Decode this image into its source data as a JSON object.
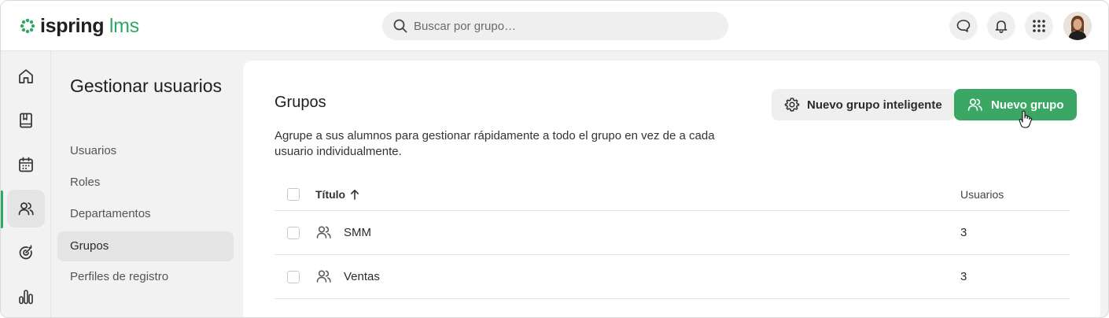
{
  "header": {
    "logo": {
      "primary": "ispring",
      "secondary": "lms"
    },
    "search": {
      "placeholder": "Buscar por grupo…",
      "value": ""
    },
    "icons": [
      "chat-icon",
      "bell-icon",
      "apps-grid-icon"
    ],
    "avatar": "user-avatar"
  },
  "rail": {
    "items": [
      "home-icon",
      "courses-book-icon",
      "calendar-icon",
      "users-icon",
      "goals-target-icon",
      "reports-chart-icon"
    ],
    "active_index": 3,
    "accent_color": "#2fa866"
  },
  "subnav": {
    "title": "Gestionar usuarios",
    "items": [
      {
        "label": "Usuarios"
      },
      {
        "label": "Roles"
      },
      {
        "label": "Departamentos"
      },
      {
        "label": "Grupos",
        "active": true
      },
      {
        "label": "Perfiles de registro"
      }
    ]
  },
  "main": {
    "title": "Grupos",
    "description": "Agrupe a sus alumnos para gestionar rápidamente a todo el grupo en vez de a cada usuario individualmente.",
    "buttons": {
      "smart_group": {
        "label": "Nuevo grupo inteligente",
        "icon": "gear-icon"
      },
      "new_group": {
        "label": "Nuevo grupo",
        "icon": "users-icon",
        "color": "#3aa764"
      }
    },
    "table": {
      "columns": {
        "title": "Título",
        "users": "Usuarios"
      },
      "sort": "ascending",
      "rows": [
        {
          "name": "SMM",
          "users": "3"
        },
        {
          "name": "Ventas",
          "users": "3"
        }
      ]
    }
  }
}
